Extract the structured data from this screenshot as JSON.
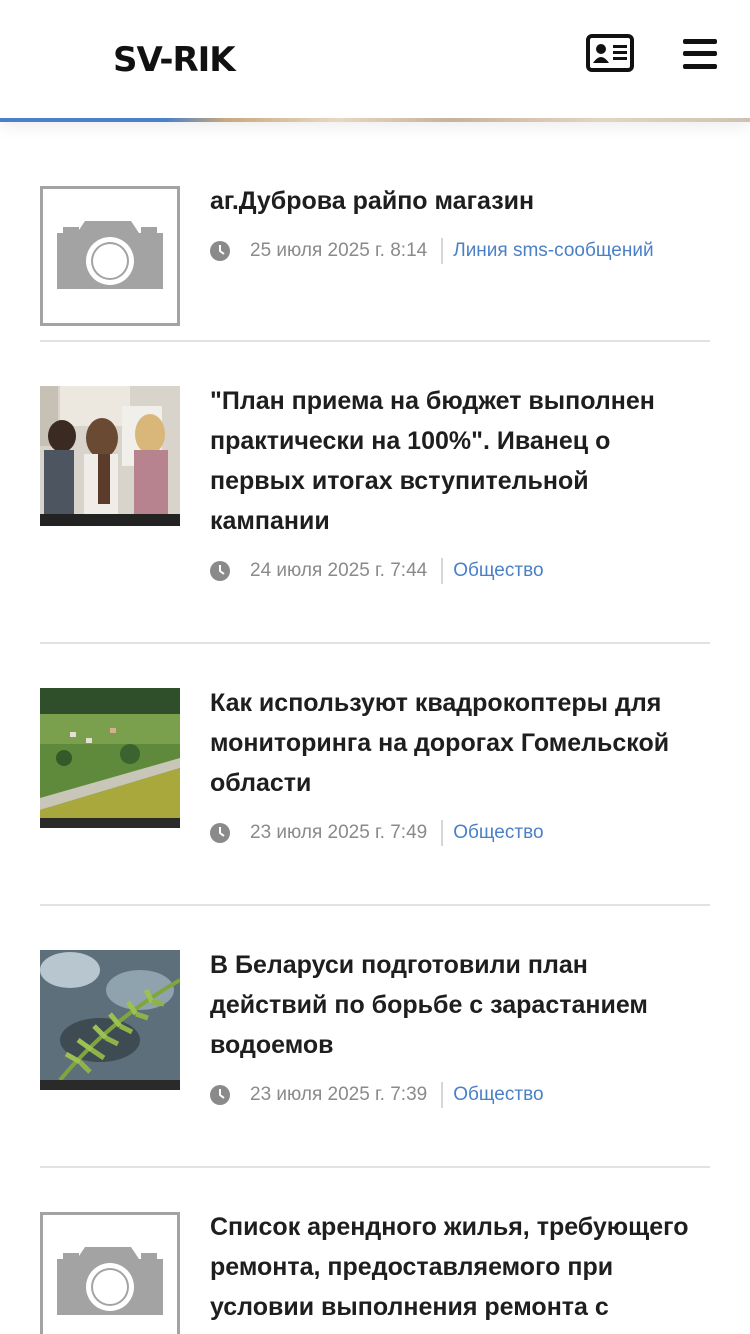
{
  "header": {
    "logo": "SV-RIK",
    "contact_icon": "contact-card-icon",
    "menu_icon": "hamburger-menu-icon"
  },
  "colors": {
    "accent": "#4a80c8",
    "meta_text": "#8a8a8a",
    "divider": "#e2e2e2"
  },
  "news": [
    {
      "title": "аг.Дуброва райпо магазин",
      "date": "25 июля 2025 г. 8:14",
      "category": "Линия sms-сообщений",
      "thumb": "camera-placeholder-icon"
    },
    {
      "title": "\"План приема на бюджет выполнен практически на 100%\". Иванец о первых итогах вступительной кампании",
      "date": "24 июля 2025 г. 7:44",
      "category": "Общество",
      "thumb": "students-photo"
    },
    {
      "title": "Как используют квадрокоптеры для мониторинга на дорогах Гомельской области",
      "date": "23 июля 2025 г. 7:49",
      "category": "Общество",
      "thumb": "aerial-road-photo"
    },
    {
      "title": "В Беларуси подготовили план действий по борьбе с зарастанием водоемов",
      "date": "23 июля 2025 г. 7:39",
      "category": "Общество",
      "thumb": "fern-water-photo"
    },
    {
      "title": "Список арендного жилья, требующего ремонта, предоставляемого при условии выполнения ремонта с",
      "date": "",
      "category": "",
      "thumb": "camera-placeholder-icon"
    }
  ]
}
